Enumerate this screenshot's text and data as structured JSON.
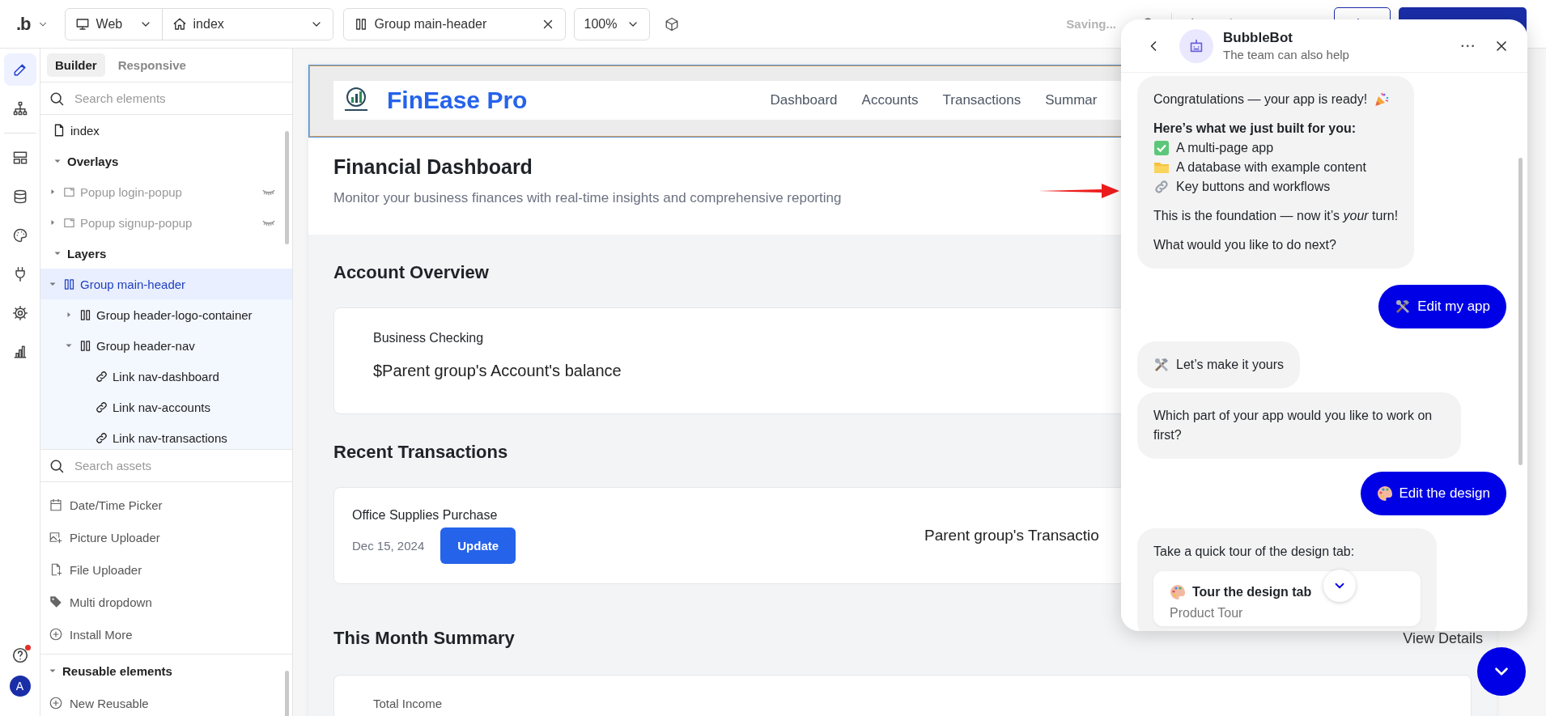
{
  "topbar": {
    "logo": ".b",
    "platform": "Web",
    "page": "index",
    "element": "Group main-header",
    "zoom": "100%",
    "status": "Saving..."
  },
  "rail_tools": [
    {
      "selected": true
    },
    {
      "selected": false
    },
    {
      "selected": false
    },
    {
      "selected": false
    },
    {
      "selected": false
    },
    {
      "selected": false
    },
    {
      "selected": false
    },
    {
      "selected": false
    }
  ],
  "help": {
    "notification": true
  },
  "account": {
    "initial": "A"
  },
  "sidebar": {
    "tabs": [
      {
        "label": "Builder",
        "selected": true
      },
      {
        "label": "Responsive",
        "selected": false
      }
    ],
    "search": {
      "placeholder": "Search elements"
    },
    "tree": [
      {
        "kind": "page",
        "label": "index",
        "selected": false
      },
      {
        "kind": "section",
        "label": "Overlays",
        "expanded": true,
        "children": [
          {
            "kind": "popup",
            "label": "Popup login-popup",
            "expanded": false,
            "selected": false,
            "hidden": true
          },
          {
            "kind": "popup",
            "label": "Popup signup-popup",
            "expanded": false,
            "selected": false,
            "hidden": true
          }
        ]
      },
      {
        "kind": "section",
        "label": "Layers",
        "expanded": true,
        "children": [
          {
            "kind": "group",
            "label": "Group main-header",
            "expanded": true,
            "selected": true,
            "children": [
              {
                "kind": "group",
                "label": "Group header-logo-container",
                "expanded": false,
                "selected": false
              },
              {
                "kind": "group",
                "label": "Group header-nav",
                "expanded": true,
                "selected": false,
                "children": [
                  {
                    "kind": "link",
                    "label": "Link nav-dashboard",
                    "selected": false
                  },
                  {
                    "kind": "link",
                    "label": "Link nav-accounts",
                    "selected": false
                  },
                  {
                    "kind": "link",
                    "label": "Link nav-transactions",
                    "selected": false
                  }
                ]
              }
            ]
          }
        ]
      }
    ],
    "asset_search": {
      "placeholder": "Search assets"
    },
    "assets": [
      "Date/Time Picker",
      "Picture Uploader",
      "File Uploader",
      "Multi dropdown",
      "Install More"
    ],
    "reusable": {
      "label": "Reusable elements",
      "expanded": true,
      "items": [
        "New Reusable"
      ]
    }
  },
  "canvas": {
    "brand": "FinEase Pro",
    "nav": [
      "Dashboard",
      "Accounts",
      "Transactions",
      "Summar"
    ],
    "title": "Financial Dashboard",
    "subtitle": "Monitor your business finances with real-time insights and comprehensive reporting",
    "sections": [
      {
        "title": "Account Overview",
        "cards": [
          {
            "kind": "account",
            "name": "Business Checking",
            "balance": "$Parent group's Account's balance"
          }
        ]
      },
      {
        "title": "Recent Transactions",
        "cards": [
          {
            "kind": "transaction",
            "name": "Office Supplies Purchase",
            "date": "Dec 15, 2024",
            "button": "Update",
            "amount": "Parent group's Transactio"
          }
        ]
      },
      {
        "title": "This Month Summary",
        "link": "View Details",
        "cards": [
          {
            "kind": "summary",
            "label": "Total Income"
          }
        ]
      }
    ]
  },
  "chat": {
    "title": "BubbleBot",
    "subtitle": "The team can also help",
    "messages": [
      {
        "kind": "bot",
        "lines": [
          {
            "kind": "party",
            "text": "Congratulations — your app is ready!"
          },
          {
            "kind": "heading",
            "text": "Here’s what we just built for you:"
          },
          {
            "kind": "check",
            "text": "A multi-page app"
          },
          {
            "kind": "folder",
            "text": "A database with example content"
          },
          {
            "kind": "link",
            "text": "Key buttons and workflows"
          },
          {
            "kind": "text",
            "text": "This is the foundation — now it’s *your* turn!"
          },
          {
            "kind": "text",
            "text": "What would you like to do next?"
          }
        ]
      },
      {
        "kind": "user",
        "lines": [
          {
            "kind": "tools",
            "text": "Edit my app"
          }
        ]
      },
      {
        "kind": "bot",
        "lines": [
          {
            "kind": "tools",
            "text": "Let’s make it yours"
          }
        ]
      },
      {
        "kind": "bot",
        "lines": [
          {
            "kind": "text",
            "text": "Which part of your app would you like to work on first?"
          }
        ]
      },
      {
        "kind": "user",
        "lines": [
          {
            "kind": "palette",
            "text": "Edit the design"
          }
        ]
      },
      {
        "kind": "bot",
        "lines": [
          {
            "kind": "text",
            "text": "Take a quick tour of the design tab:"
          }
        ],
        "card": {
          "kind": "palette",
          "title": "Tour the design tab",
          "subtitle": "Product Tour"
        }
      }
    ]
  }
}
